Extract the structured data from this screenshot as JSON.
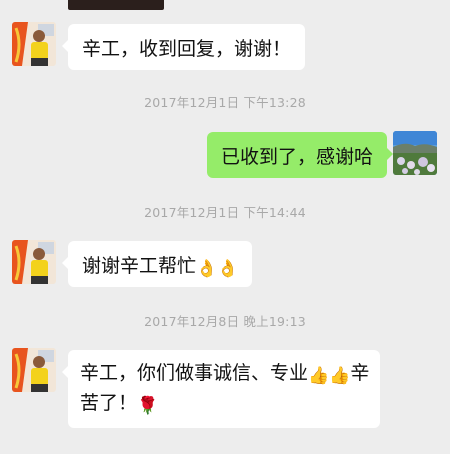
{
  "messages": [
    {
      "side": "left",
      "text": "辛工，收到回复，谢谢！"
    },
    {
      "timestamp": "2017年12月1日 下午13:28"
    },
    {
      "side": "right",
      "text": "已收到了，感谢哈"
    },
    {
      "timestamp": "2017年12月1日 下午14:44"
    },
    {
      "side": "left",
      "text": "谢谢辛工帮忙",
      "emoji": "👌👌"
    },
    {
      "timestamp": "2017年12月8日 晚上19:13"
    },
    {
      "side": "left",
      "line1_text": "辛工，你们做事诚信、专业",
      "line1_emoji": "👍👍",
      "line1_tail": "辛",
      "line2_text": "苦了！",
      "line2_emoji": "🌹"
    }
  ],
  "icons": {
    "contact_avatar": "contact-avatar-icon",
    "self_avatar": "self-avatar-icon",
    "ok_hand": "ok-hand-icon",
    "thumbs_up": "thumbs-up-icon",
    "rose": "rose-icon"
  },
  "colors": {
    "background": "#ededed",
    "bubble_left": "#ffffff",
    "bubble_right": "#95ec69",
    "timestamp": "#a8a8a8"
  }
}
